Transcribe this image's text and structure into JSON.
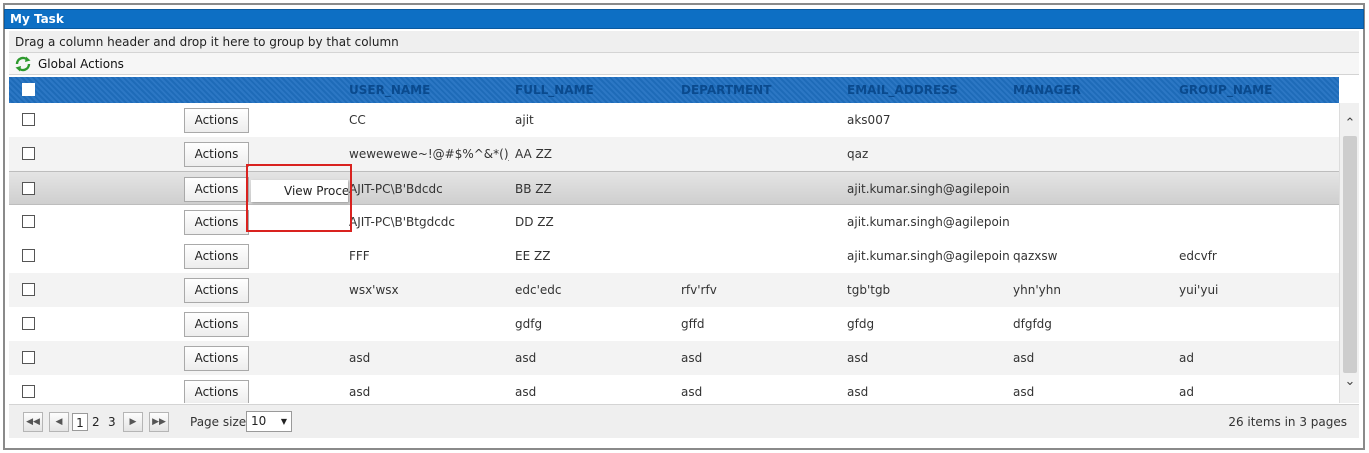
{
  "panel": {
    "title": "My Task"
  },
  "group_bar": {
    "text": "Drag a column header and drop it here to group by that column"
  },
  "toolbar": {
    "global_actions_label": "Global Actions",
    "icon": "refresh-icon"
  },
  "columns": [
    "USER_NAME",
    "FULL_NAME",
    "DEPARTMENT",
    "EMAIL_ADDRESS",
    "MANAGER",
    "GROUP_NAME"
  ],
  "action_label": "Actions",
  "rows": [
    {
      "user_name": "CC",
      "full_name": "ajit",
      "department": "",
      "email": "aks007",
      "manager": "",
      "group_name": ""
    },
    {
      "user_name": "wewewewe~!@#$%^&*()_+",
      "full_name": "AA ZZ",
      "department": "",
      "email": "qaz",
      "manager": "",
      "group_name": ""
    },
    {
      "user_name": "AJIT-PC\\B'Bdcdc",
      "full_name": "BB ZZ",
      "department": "",
      "email": "ajit.kumar.singh@agilepoint.com",
      "manager": "",
      "group_name": ""
    },
    {
      "user_name": "AJIT-PC\\B'Btgdcdc",
      "full_name": "DD ZZ",
      "department": "",
      "email": "ajit.kumar.singh@agilepoint.com",
      "manager": "",
      "group_name": ""
    },
    {
      "user_name": "FFF",
      "full_name": "EE ZZ",
      "department": "",
      "email": "ajit.kumar.singh@agilepoint.com",
      "manager": "qazxsw",
      "group_name": "edcvfr"
    },
    {
      "user_name": "wsx'wsx",
      "full_name": "edc'edc",
      "department": "rfv'rfv",
      "email": "tgb'tgb",
      "manager": "yhn'yhn",
      "group_name": "yui'yui"
    },
    {
      "user_name": "",
      "full_name": "gdfg",
      "department": "gffd",
      "email": "gfdg",
      "manager": "dfgfdg",
      "group_name": ""
    },
    {
      "user_name": "asd",
      "full_name": "asd",
      "department": "asd",
      "email": "asd",
      "manager": "asd",
      "group_name": "ad"
    },
    {
      "user_name": "asd",
      "full_name": "asd",
      "department": "asd",
      "email": "asd",
      "manager": "asd",
      "group_name": "ad"
    }
  ],
  "context_menu": {
    "item": "View Process"
  },
  "pager": {
    "first_icon": "first-page-icon",
    "prev_icon": "prev-page-icon",
    "next_icon": "next-page-icon",
    "last_icon": "last-page-icon",
    "pages": [
      "1",
      "2",
      "3"
    ],
    "current_page": "1",
    "page_size_label": "Page size:",
    "page_size": "10",
    "info": "26 items in 3 pages"
  }
}
